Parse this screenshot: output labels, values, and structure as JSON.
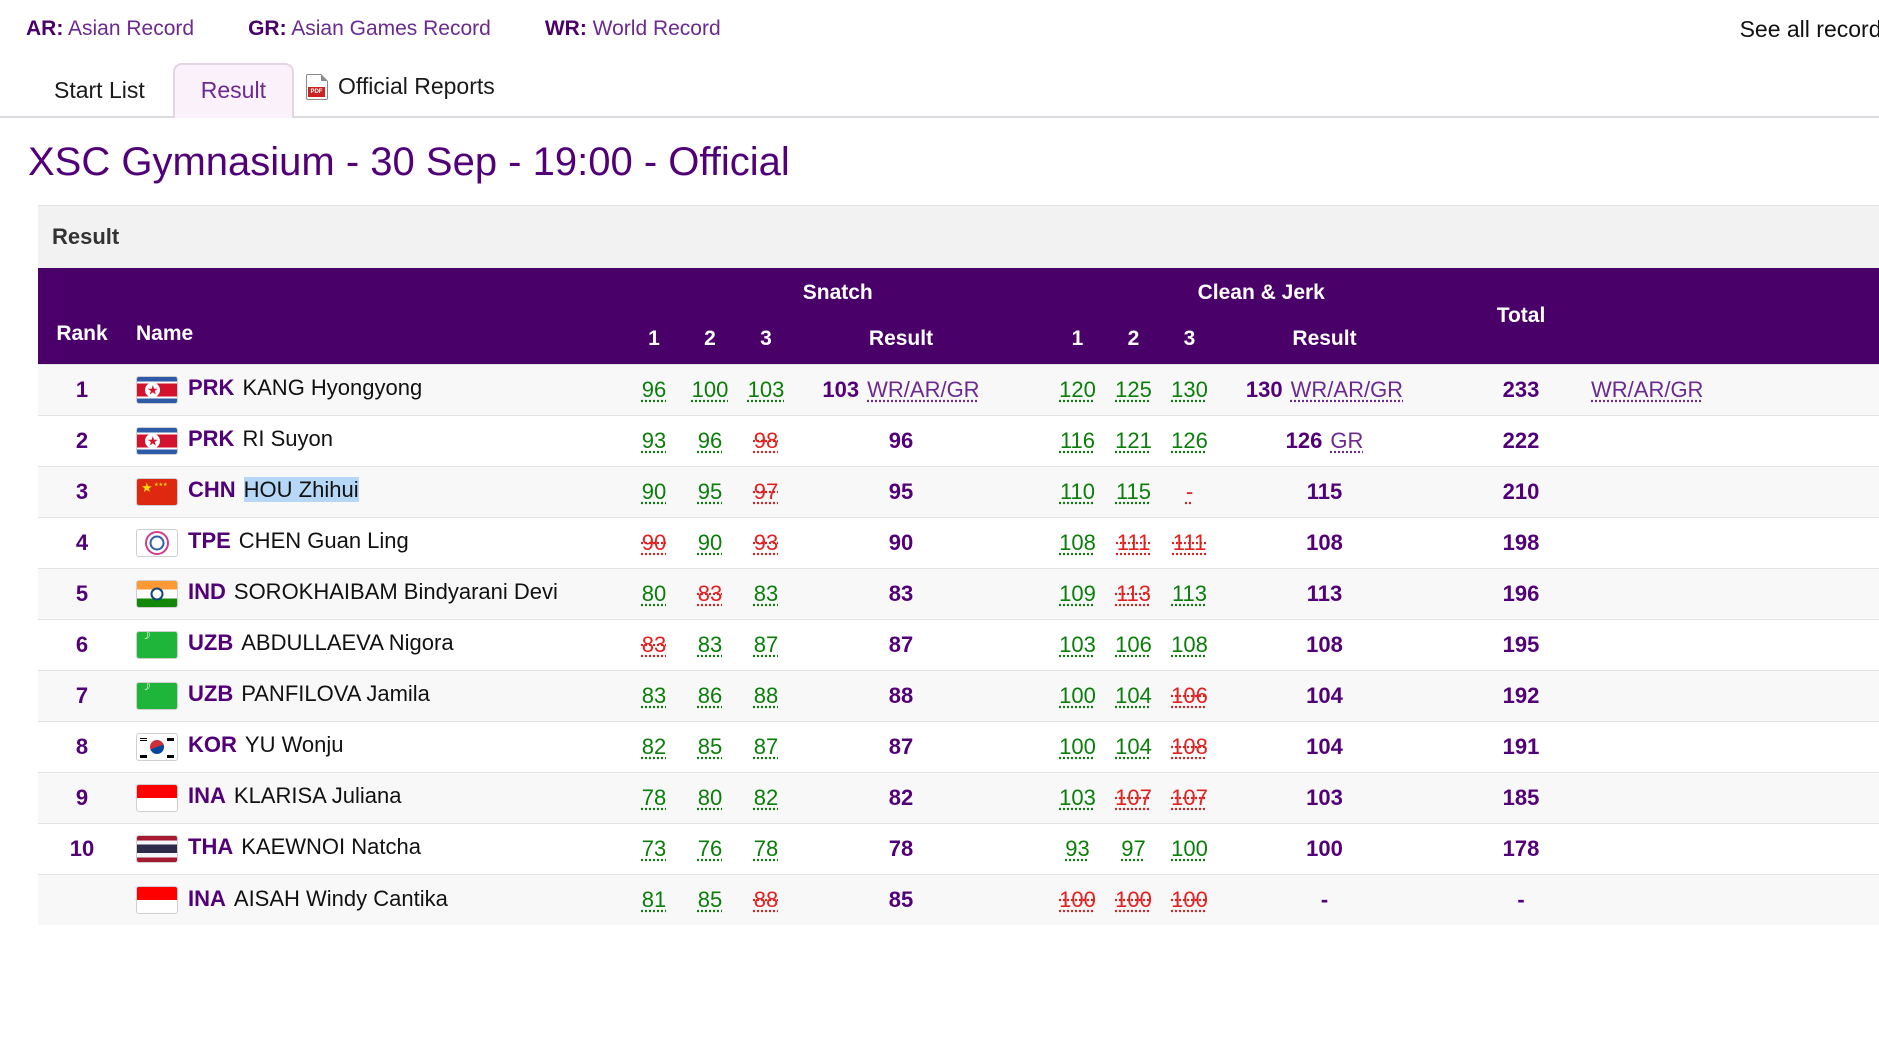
{
  "legend": {
    "items": [
      {
        "abbr": "AR:",
        "text": " Asian Record"
      },
      {
        "abbr": "GR:",
        "text": " Asian Games Record"
      },
      {
        "abbr": "WR:",
        "text": " World Record"
      }
    ],
    "see_all": "See all records"
  },
  "tabs": [
    {
      "label": "Start List",
      "active": false
    },
    {
      "label": "Result",
      "active": true
    }
  ],
  "reports": {
    "label": "Official Reports",
    "icon": "pdf-icon"
  },
  "page_title": "XSC Gymnasium - 30 Sep - 19:00 - Official",
  "panel": {
    "heading": "Result"
  },
  "table": {
    "headers": {
      "rank": "Rank",
      "name": "Name",
      "snatch": "Snatch",
      "clean_jerk": "Clean & Jerk",
      "attempt_1": "1",
      "attempt_2": "2",
      "attempt_3": "3",
      "result": "Result",
      "total": "Total"
    },
    "rows": [
      {
        "rank": "1",
        "flag": "flag-prk",
        "noc": "PRK",
        "athlete": "KANG Hyongyong",
        "selected": false,
        "snatch": [
          {
            "v": "96",
            "s": "good"
          },
          {
            "v": "100",
            "s": "good"
          },
          {
            "v": "103",
            "s": "good"
          }
        ],
        "snatch_result": "103",
        "snatch_record": "WR/AR/GR",
        "cj": [
          {
            "v": "120",
            "s": "good"
          },
          {
            "v": "125",
            "s": "good"
          },
          {
            "v": "130",
            "s": "good"
          }
        ],
        "cj_result": "130",
        "cj_record": "WR/AR/GR",
        "total": "233",
        "total_record": "WR/AR/GR"
      },
      {
        "rank": "2",
        "flag": "flag-prk",
        "noc": "PRK",
        "athlete": "RI Suyon",
        "selected": false,
        "snatch": [
          {
            "v": "93",
            "s": "good"
          },
          {
            "v": "96",
            "s": "good"
          },
          {
            "v": "98",
            "s": "fail"
          }
        ],
        "snatch_result": "96",
        "snatch_record": "",
        "cj": [
          {
            "v": "116",
            "s": "good"
          },
          {
            "v": "121",
            "s": "good"
          },
          {
            "v": "126",
            "s": "good"
          }
        ],
        "cj_result": "126",
        "cj_record": "GR",
        "total": "222",
        "total_record": ""
      },
      {
        "rank": "3",
        "flag": "flag-chn",
        "noc": "CHN",
        "athlete": "HOU Zhihui",
        "selected": true,
        "snatch": [
          {
            "v": "90",
            "s": "good"
          },
          {
            "v": "95",
            "s": "good"
          },
          {
            "v": "97",
            "s": "fail"
          }
        ],
        "snatch_result": "95",
        "snatch_record": "",
        "cj": [
          {
            "v": "110",
            "s": "good"
          },
          {
            "v": "115",
            "s": "good"
          },
          {
            "v": "-",
            "s": "none"
          }
        ],
        "cj_result": "115",
        "cj_record": "",
        "total": "210",
        "total_record": ""
      },
      {
        "rank": "4",
        "flag": "flag-tpe",
        "noc": "TPE",
        "athlete": "CHEN Guan Ling",
        "selected": false,
        "snatch": [
          {
            "v": "90",
            "s": "fail"
          },
          {
            "v": "90",
            "s": "good"
          },
          {
            "v": "93",
            "s": "fail"
          }
        ],
        "snatch_result": "90",
        "snatch_record": "",
        "cj": [
          {
            "v": "108",
            "s": "good"
          },
          {
            "v": "111",
            "s": "fail"
          },
          {
            "v": "111",
            "s": "fail"
          }
        ],
        "cj_result": "108",
        "cj_record": "",
        "total": "198",
        "total_record": ""
      },
      {
        "rank": "5",
        "flag": "flag-ind",
        "noc": "IND",
        "athlete": "SOROKHAIBAM Bindyarani Devi",
        "selected": false,
        "snatch": [
          {
            "v": "80",
            "s": "good"
          },
          {
            "v": "83",
            "s": "fail"
          },
          {
            "v": "83",
            "s": "good"
          }
        ],
        "snatch_result": "83",
        "snatch_record": "",
        "cj": [
          {
            "v": "109",
            "s": "good"
          },
          {
            "v": "113",
            "s": "fail"
          },
          {
            "v": "113",
            "s": "good"
          }
        ],
        "cj_result": "113",
        "cj_record": "",
        "total": "196",
        "total_record": ""
      },
      {
        "rank": "6",
        "flag": "flag-uzb",
        "noc": "UZB",
        "athlete": "ABDULLAEVA Nigora",
        "selected": false,
        "snatch": [
          {
            "v": "83",
            "s": "fail"
          },
          {
            "v": "83",
            "s": "good"
          },
          {
            "v": "87",
            "s": "good"
          }
        ],
        "snatch_result": "87",
        "snatch_record": "",
        "cj": [
          {
            "v": "103",
            "s": "good"
          },
          {
            "v": "106",
            "s": "good"
          },
          {
            "v": "108",
            "s": "good"
          }
        ],
        "cj_result": "108",
        "cj_record": "",
        "total": "195",
        "total_record": ""
      },
      {
        "rank": "7",
        "flag": "flag-uzb",
        "noc": "UZB",
        "athlete": "PANFILOVA Jamila",
        "selected": false,
        "snatch": [
          {
            "v": "83",
            "s": "good"
          },
          {
            "v": "86",
            "s": "good"
          },
          {
            "v": "88",
            "s": "good"
          }
        ],
        "snatch_result": "88",
        "snatch_record": "",
        "cj": [
          {
            "v": "100",
            "s": "good"
          },
          {
            "v": "104",
            "s": "good"
          },
          {
            "v": "106",
            "s": "fail"
          }
        ],
        "cj_result": "104",
        "cj_record": "",
        "total": "192",
        "total_record": ""
      },
      {
        "rank": "8",
        "flag": "flag-kor",
        "noc": "KOR",
        "athlete": "YU Wonju",
        "selected": false,
        "snatch": [
          {
            "v": "82",
            "s": "good"
          },
          {
            "v": "85",
            "s": "good"
          },
          {
            "v": "87",
            "s": "good"
          }
        ],
        "snatch_result": "87",
        "snatch_record": "",
        "cj": [
          {
            "v": "100",
            "s": "good"
          },
          {
            "v": "104",
            "s": "good"
          },
          {
            "v": "108",
            "s": "fail"
          }
        ],
        "cj_result": "104",
        "cj_record": "",
        "total": "191",
        "total_record": ""
      },
      {
        "rank": "9",
        "flag": "flag-ina",
        "noc": "INA",
        "athlete": "KLARISA Juliana",
        "selected": false,
        "snatch": [
          {
            "v": "78",
            "s": "good"
          },
          {
            "v": "80",
            "s": "good"
          },
          {
            "v": "82",
            "s": "good"
          }
        ],
        "snatch_result": "82",
        "snatch_record": "",
        "cj": [
          {
            "v": "103",
            "s": "good"
          },
          {
            "v": "107",
            "s": "fail"
          },
          {
            "v": "107",
            "s": "fail"
          }
        ],
        "cj_result": "103",
        "cj_record": "",
        "total": "185",
        "total_record": ""
      },
      {
        "rank": "10",
        "flag": "flag-tha",
        "noc": "THA",
        "athlete": "KAEWNOI Natcha",
        "selected": false,
        "snatch": [
          {
            "v": "73",
            "s": "good"
          },
          {
            "v": "76",
            "s": "good"
          },
          {
            "v": "78",
            "s": "good"
          }
        ],
        "snatch_result": "78",
        "snatch_record": "",
        "cj": [
          {
            "v": "93",
            "s": "good"
          },
          {
            "v": "97",
            "s": "good"
          },
          {
            "v": "100",
            "s": "good"
          }
        ],
        "cj_result": "100",
        "cj_record": "",
        "total": "178",
        "total_record": ""
      },
      {
        "rank": "",
        "flag": "flag-ina",
        "noc": "INA",
        "athlete": "AISAH Windy Cantika",
        "selected": false,
        "snatch": [
          {
            "v": "81",
            "s": "good"
          },
          {
            "v": "85",
            "s": "good"
          },
          {
            "v": "88",
            "s": "fail"
          }
        ],
        "snatch_result": "85",
        "snatch_record": "",
        "cj": [
          {
            "v": "100",
            "s": "fail"
          },
          {
            "v": "100",
            "s": "fail"
          },
          {
            "v": "100",
            "s": "fail"
          }
        ],
        "cj_result": "-",
        "cj_record": "",
        "total": "-",
        "total_record": ""
      }
    ]
  },
  "colors": {
    "header_purple": "#4a0069",
    "title_purple": "#520078",
    "link_purple": "#6b2a8f",
    "good_green": "#0a7d0a",
    "fail_red": "#e32020",
    "selection_blue": "#b6d7f5",
    "tab_active_bg": "#fbf1fa"
  }
}
